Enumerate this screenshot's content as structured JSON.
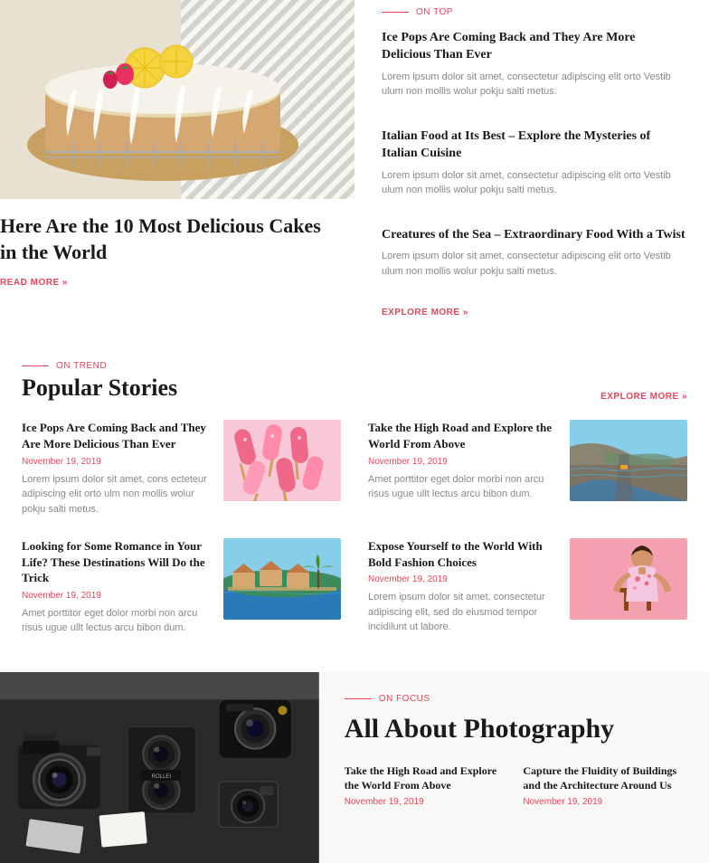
{
  "on_top": {
    "label_line": "",
    "label_text": "On Top",
    "articles": [
      {
        "title": "Ice Pops Are Coming Back and They Are More Delicious Than Ever",
        "description": "Lorem ipsum dolor sit amet, consectetur adipiscing elit orto Vestib ulum non mollis wolur pokju salti metus."
      },
      {
        "title": "Italian Food at Its Best – Explore the Mysteries of Italian Cuisine",
        "description": "Lorem ipsum dolor sit amet, consectetur adipiscing elit orto Vestib ulum non mollis wolur pokju salti metus."
      },
      {
        "title": "Creatures of the Sea – Extraordinary Food With a Twist",
        "description": "Lorem ipsum dolor sit amet, consectetur adipiscing elit orto Vestib ulum non mollis wolur pokju salti metus."
      }
    ],
    "explore_more": "EXPLORE MORE »"
  },
  "hero": {
    "title": "Here Are the 10 Most Delicious Cakes in the World",
    "read_more": "READ MORE »"
  },
  "popular": {
    "label_text": "On Trend",
    "section_title": "Popular Stories",
    "explore_more": "EXPLORE MORE »",
    "stories": [
      {
        "title": "Ice Pops Are Coming Back and They Are More Delicious Than Ever",
        "date": "November 19, 2019",
        "description": "Lorem ipsum dolor sit amet, cons ecteteur adipiscing elit orto ulm non mollis wolur pokju salti metus.",
        "thumb_type": "pops"
      },
      {
        "title": "Take the High Road and Explore the World From Above",
        "date": "November 19, 2019",
        "description": "Amet porttitor eget dolor morbi non arcu risus ugue ullt lectus arcu bibon dum.",
        "thumb_type": "road"
      },
      {
        "title": "Looking for Some Romance in Your Life? These Destinations Will Do the Trick",
        "date": "November 19, 2019",
        "description": "Amet porttitor eget dolor morbi non arcu risus ugue ullt lectus arcu bibon dum.",
        "thumb_type": "resort"
      },
      {
        "title": "Expose Yourself to the World With Bold Fashion Choices",
        "date": "November 19, 2019",
        "description": "Lorem ipsum dolor sit amet, consectetur adipiscing elit, sed do eiusmod tempor incidilunt ut labore.",
        "thumb_type": "fashion"
      }
    ]
  },
  "photography": {
    "label_text": "On Focus",
    "section_title": "All About Photography",
    "sub_articles": [
      {
        "title": "Take the High Road and Explore the World From Above",
        "date": "November 19, 2019"
      },
      {
        "title": "Capture the Fluidity of Buildings and the Architecture Around Us",
        "date": "November 19, 2019"
      }
    ]
  }
}
